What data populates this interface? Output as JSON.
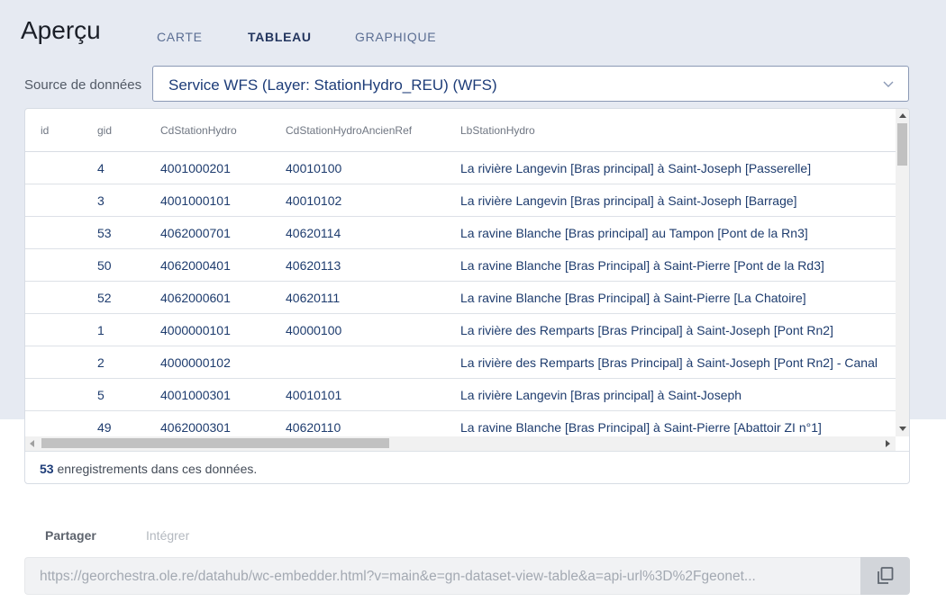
{
  "header": {
    "title": "Aperçu",
    "tabs": [
      {
        "label": "CARTE",
        "active": false
      },
      {
        "label": "TABLEAU",
        "active": true
      },
      {
        "label": "GRAPHIQUE",
        "active": false
      }
    ]
  },
  "source": {
    "label": "Source de données",
    "selected": "Service WFS (Layer: StationHydro_REU) (WFS)"
  },
  "table": {
    "columns": [
      "id",
      "gid",
      "CdStationHydro",
      "CdStationHydroAncienRef",
      "LbStationHydro"
    ],
    "rows": [
      {
        "id": "",
        "gid": "4",
        "CdStationHydro": "4001000201",
        "CdStationHydroAncienRef": "40010100",
        "LbStationHydro": "La rivière Langevin [Bras principal] à Saint-Joseph [Passerelle]"
      },
      {
        "id": "",
        "gid": "3",
        "CdStationHydro": "4001000101",
        "CdStationHydroAncienRef": "40010102",
        "LbStationHydro": "La rivière Langevin [Bras principal] à Saint-Joseph [Barrage]"
      },
      {
        "id": "",
        "gid": "53",
        "CdStationHydro": "4062000701",
        "CdStationHydroAncienRef": "40620114",
        "LbStationHydro": "La ravine Blanche [Bras principal] au Tampon [Pont de la Rn3]"
      },
      {
        "id": "",
        "gid": "50",
        "CdStationHydro": "4062000401",
        "CdStationHydroAncienRef": "40620113",
        "LbStationHydro": "La ravine Blanche [Bras Principal] à Saint-Pierre [Pont de la Rd3]"
      },
      {
        "id": "",
        "gid": "52",
        "CdStationHydro": "4062000601",
        "CdStationHydroAncienRef": "40620111",
        "LbStationHydro": "La ravine Blanche [Bras Principal] à Saint-Pierre [La Chatoire]"
      },
      {
        "id": "",
        "gid": "1",
        "CdStationHydro": "4000000101",
        "CdStationHydroAncienRef": "40000100",
        "LbStationHydro": "La rivière des Remparts [Bras Principal] à Saint-Joseph [Pont Rn2]"
      },
      {
        "id": "",
        "gid": "2",
        "CdStationHydro": "4000000102",
        "CdStationHydroAncienRef": "",
        "LbStationHydro": "La rivière des Remparts [Bras Principal] à Saint-Joseph [Pont Rn2] - Canal"
      },
      {
        "id": "",
        "gid": "5",
        "CdStationHydro": "4001000301",
        "CdStationHydroAncienRef": "40010101",
        "LbStationHydro": "La rivière Langevin [Bras principal] à Saint-Joseph"
      },
      {
        "id": "",
        "gid": "49",
        "CdStationHydro": "4062000301",
        "CdStationHydroAncienRef": "40620110",
        "LbStationHydro": "La ravine Blanche [Bras Principal] à Saint-Pierre [Abattoir ZI n°1]"
      }
    ]
  },
  "footer": {
    "record_count": "53",
    "record_text": " enregistrements dans ces données."
  },
  "share": {
    "tabs": [
      {
        "label": "Partager",
        "active": true
      },
      {
        "label": "Intégrer",
        "active": false
      }
    ],
    "url": "https://georchestra.ole.re/datahub/wc-embedder.html?v=main&e=gn-dataset-view-table&a=api-url%3D%2Fgeonet..."
  },
  "colors": {
    "band": "#e6eaf2",
    "accent": "#1d3c78",
    "tab_inactive": "#5b6e93"
  }
}
